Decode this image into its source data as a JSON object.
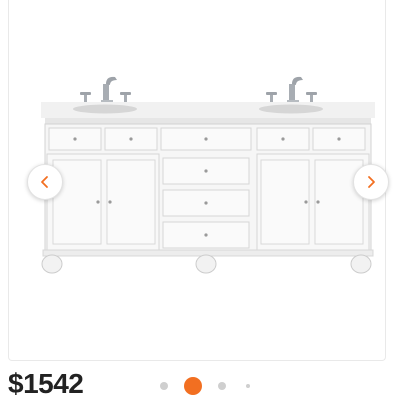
{
  "product": {
    "price": "$1542",
    "image_icon": "double-sink-vanity-image"
  },
  "carousel": {
    "prev_icon": "chevron-left-icon",
    "next_icon": "chevron-right-icon",
    "active_index": 1,
    "dot_count": 4
  },
  "colors": {
    "accent": "#f26f21",
    "inactive_dot": "#cfcfcf",
    "price_text": "#222222"
  }
}
